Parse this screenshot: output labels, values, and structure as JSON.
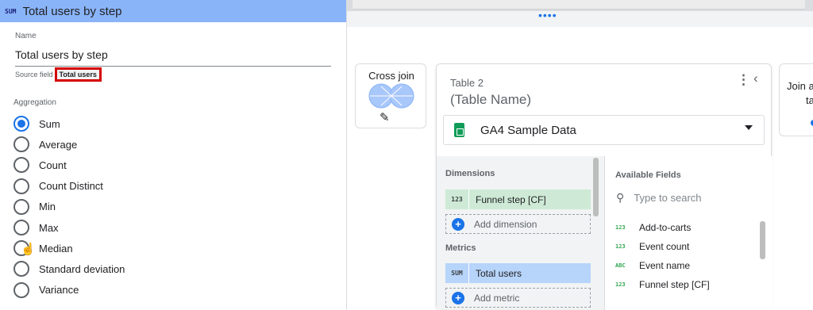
{
  "field_panel": {
    "type_badge": "SUM",
    "title": "Total users by step",
    "name_label": "Name",
    "name_value": "Total users by step",
    "source_field_label": "Source field",
    "source_field_value": "Total users",
    "aggregation_label": "Aggregation",
    "aggregation_options": [
      "Sum",
      "Average",
      "Count",
      "Count Distinct",
      "Min",
      "Max",
      "Median",
      "Standard deviation",
      "Variance"
    ],
    "aggregation_selected": "Sum"
  },
  "join_card": {
    "title": "Cross join",
    "edit_icon": "pencil-icon"
  },
  "table_card": {
    "title": "Table 2",
    "subtitle": "(Table Name)",
    "data_source": "GA4 Sample Data",
    "dimensions_label": "Dimensions",
    "dimensions": [
      {
        "code": "123",
        "name": "Funnel step [CF]"
      }
    ],
    "add_dimension_label": "Add dimension",
    "metrics_label": "Metrics",
    "metrics": [
      {
        "code": "SUM",
        "name": "Total users"
      }
    ],
    "add_metric_label": "Add metric",
    "available_label": "Available Fields",
    "search_placeholder": "Type to search",
    "available_fields": [
      {
        "code": "123",
        "name": "Add-to-carts"
      },
      {
        "code": "123",
        "name": "Event count"
      },
      {
        "code": "ABC",
        "name": "Event name"
      },
      {
        "code": "123",
        "name": "Funnel step [CF]"
      }
    ]
  },
  "partial_join_card": {
    "line1": "Join a",
    "line2": "ta"
  },
  "colors": {
    "header_blue": "#8ab4f8",
    "accent": "#1a73e8",
    "dimension_green": "#ceead6",
    "metric_blue": "#b7d4fa",
    "highlight_red": "#d50000"
  }
}
